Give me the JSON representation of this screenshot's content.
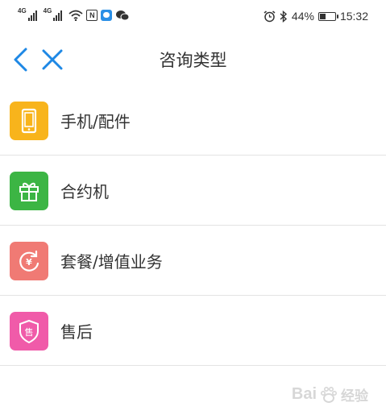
{
  "status_bar": {
    "sim1_tag": "4G",
    "sim2_tag": "4G",
    "nfc_icon": "N",
    "battery_level": 0.44,
    "battery_text": "44%",
    "time": "15:32"
  },
  "nav": {
    "title": "咨询类型"
  },
  "colors": {
    "accent": "#1e88e5",
    "phone": "#f8b41c",
    "contract": "#3cb544",
    "package": "#f07a74",
    "after_sale": "#f05ba9"
  },
  "items": [
    {
      "label": "手机/配件",
      "icon": "phone-icon",
      "color": "#f8b41c"
    },
    {
      "label": "合约机",
      "icon": "gift-icon",
      "color": "#3cb544"
    },
    {
      "label": "套餐/增值业务",
      "icon": "yuan-refresh-icon",
      "color": "#f07a74"
    },
    {
      "label": "售后",
      "icon": "shield-sale-icon",
      "color": "#f05ba9",
      "glyph": "售"
    }
  ],
  "watermark": {
    "brand": "Bai",
    "suffix": "经验"
  }
}
